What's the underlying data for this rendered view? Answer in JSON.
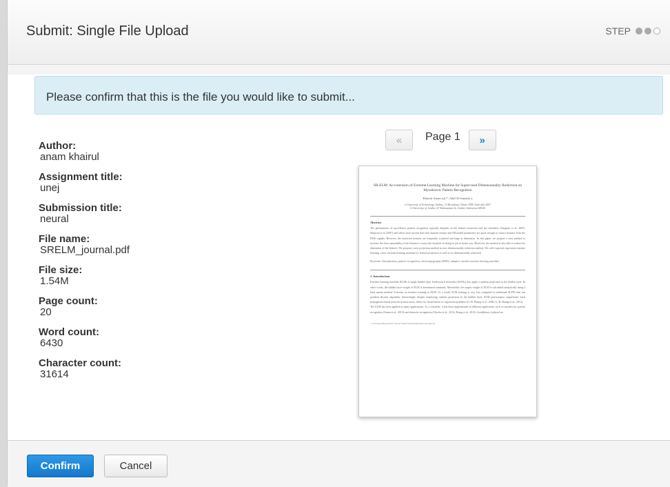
{
  "header": {
    "title": "Submit: Single File Upload",
    "step_label": "STEP",
    "steps": [
      "filled",
      "filled",
      "empty"
    ]
  },
  "alert": {
    "message": "Please confirm that this is the file you would like to submit..."
  },
  "metadata": [
    {
      "label": "Author:",
      "value": "anam khairul"
    },
    {
      "label": "Assignment title:",
      "value": "unej"
    },
    {
      "label": "Submission title:",
      "value": "neural"
    },
    {
      "label": "File name:",
      "value": "SRELM_journal.pdf"
    },
    {
      "label": "File size:",
      "value": "1.54M"
    },
    {
      "label": "Page count:",
      "value": "20"
    },
    {
      "label": "Word count:",
      "value": "6430"
    },
    {
      "label": "Character count:",
      "value": "31614"
    }
  ],
  "pager": {
    "prev_label": "«",
    "page_label": "Page 1",
    "next_label": "»"
  },
  "preview": {
    "title": "SR-ELM: An extension of Extreme Learning Machine for Supervised Dimensionality Reduction on Myoelectric Pattern Recognition",
    "authors": "Khairul Anam a,b,*, Adel Al-Jumaily a",
    "affiliation_1": "a University of Technology, Sydney, 15 Broadway Ultimo NSW Australia 2007",
    "affiliation_2": "b University of Jember, 67 Kalimantan St, Jember, Indonesia 68146",
    "abstract_heading": "Abstract",
    "abstract_text": "The performance of myoelectric pattern recognition typically depends on the feature extraction and the classifiers (Simpson et al. 2007). Simpson et al (2007) and others have proven that time domain feature and AR model parameters are good enough to extract features from the EMG signals. However, the extracted features are frequently scattered and large in dimension. In this paper, we propose a new method to increase the class separability of the features to assist the classifier in doing its job in better way. Moreover, the method is also able to reduce the dimension of the features. We propose a new projection method as new dimensionality reduction method. We call it spectral regression extreme learning, a new extreme learning machine for feature projection as well as for dimensionality reduction.",
    "keywords": "Keyword: Classification, pattern recognition, electromyography (EMG), adaptive wavelet extreme learning machine",
    "intro_heading": "1.  Introduction",
    "intro_text_1": "Extreme learning machine (ELM) is single hidden layer feedforward networks (SLFNs) that apply a random projection in the hidden layer. In other words, the hidden layer weight of ELM is determined randomly. Meanwhile, the output weight of ELM is calculated analytically using a least square method. It means no iterative training in ELM. As a result, ELM training is very fast compared to traditional SLFNs that use gradient descent algorithm. Interestingly, despite employing random projection in the hidden layer, ELM performance outperforms back propagation neural network in most areas, either for classification or regression problems (G.-B. Huang et al., 2006; G.-B. Huang et al., 2012).",
    "intro_text_2": "The ELM has been applied in many applications. As a classifier, it has been implemented in different application, such as myoelectric pattern recognition (Anam et al., 2013) and character recognition (Chacko et al., 2012; Zhang et al., 2013). In addition, it played an",
    "footnote": "* Corresponding author. Email: Khairul.Anam@student.uts.edu.au"
  },
  "footer": {
    "confirm_label": "Confirm",
    "cancel_label": "Cancel"
  },
  "colors": {
    "primary": "#1a7fcb",
    "alert_bg": "#dbeef5"
  }
}
